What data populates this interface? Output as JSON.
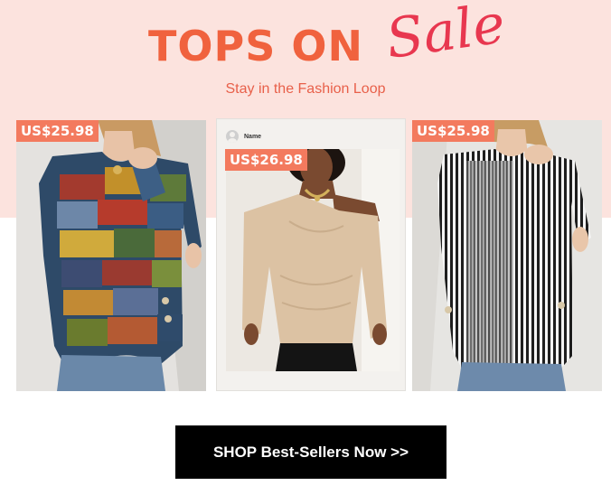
{
  "banner": {
    "headline_main": "TOPS ON",
    "headline_script": "Sale",
    "subtitle": "Stay in the Fashion Loop"
  },
  "products": [
    {
      "price": "US$25.98",
      "image": "patchwork-print-top-photo"
    },
    {
      "price": "US$26.98",
      "image": "satin-off-shoulder-blouse-photo"
    },
    {
      "price": "US$25.98",
      "image": "striped-top-photo"
    }
  ],
  "social_post": {
    "name": "Name",
    "avatar_icon": "user-avatar-icon"
  },
  "cta": {
    "label": "SHOP Best-Sellers Now >>"
  },
  "colors": {
    "hero_background": "#fce3de",
    "headline": "#f0623e",
    "script": "#e8374f",
    "price_tag": "#f37a5e",
    "cta_background": "#000000"
  }
}
